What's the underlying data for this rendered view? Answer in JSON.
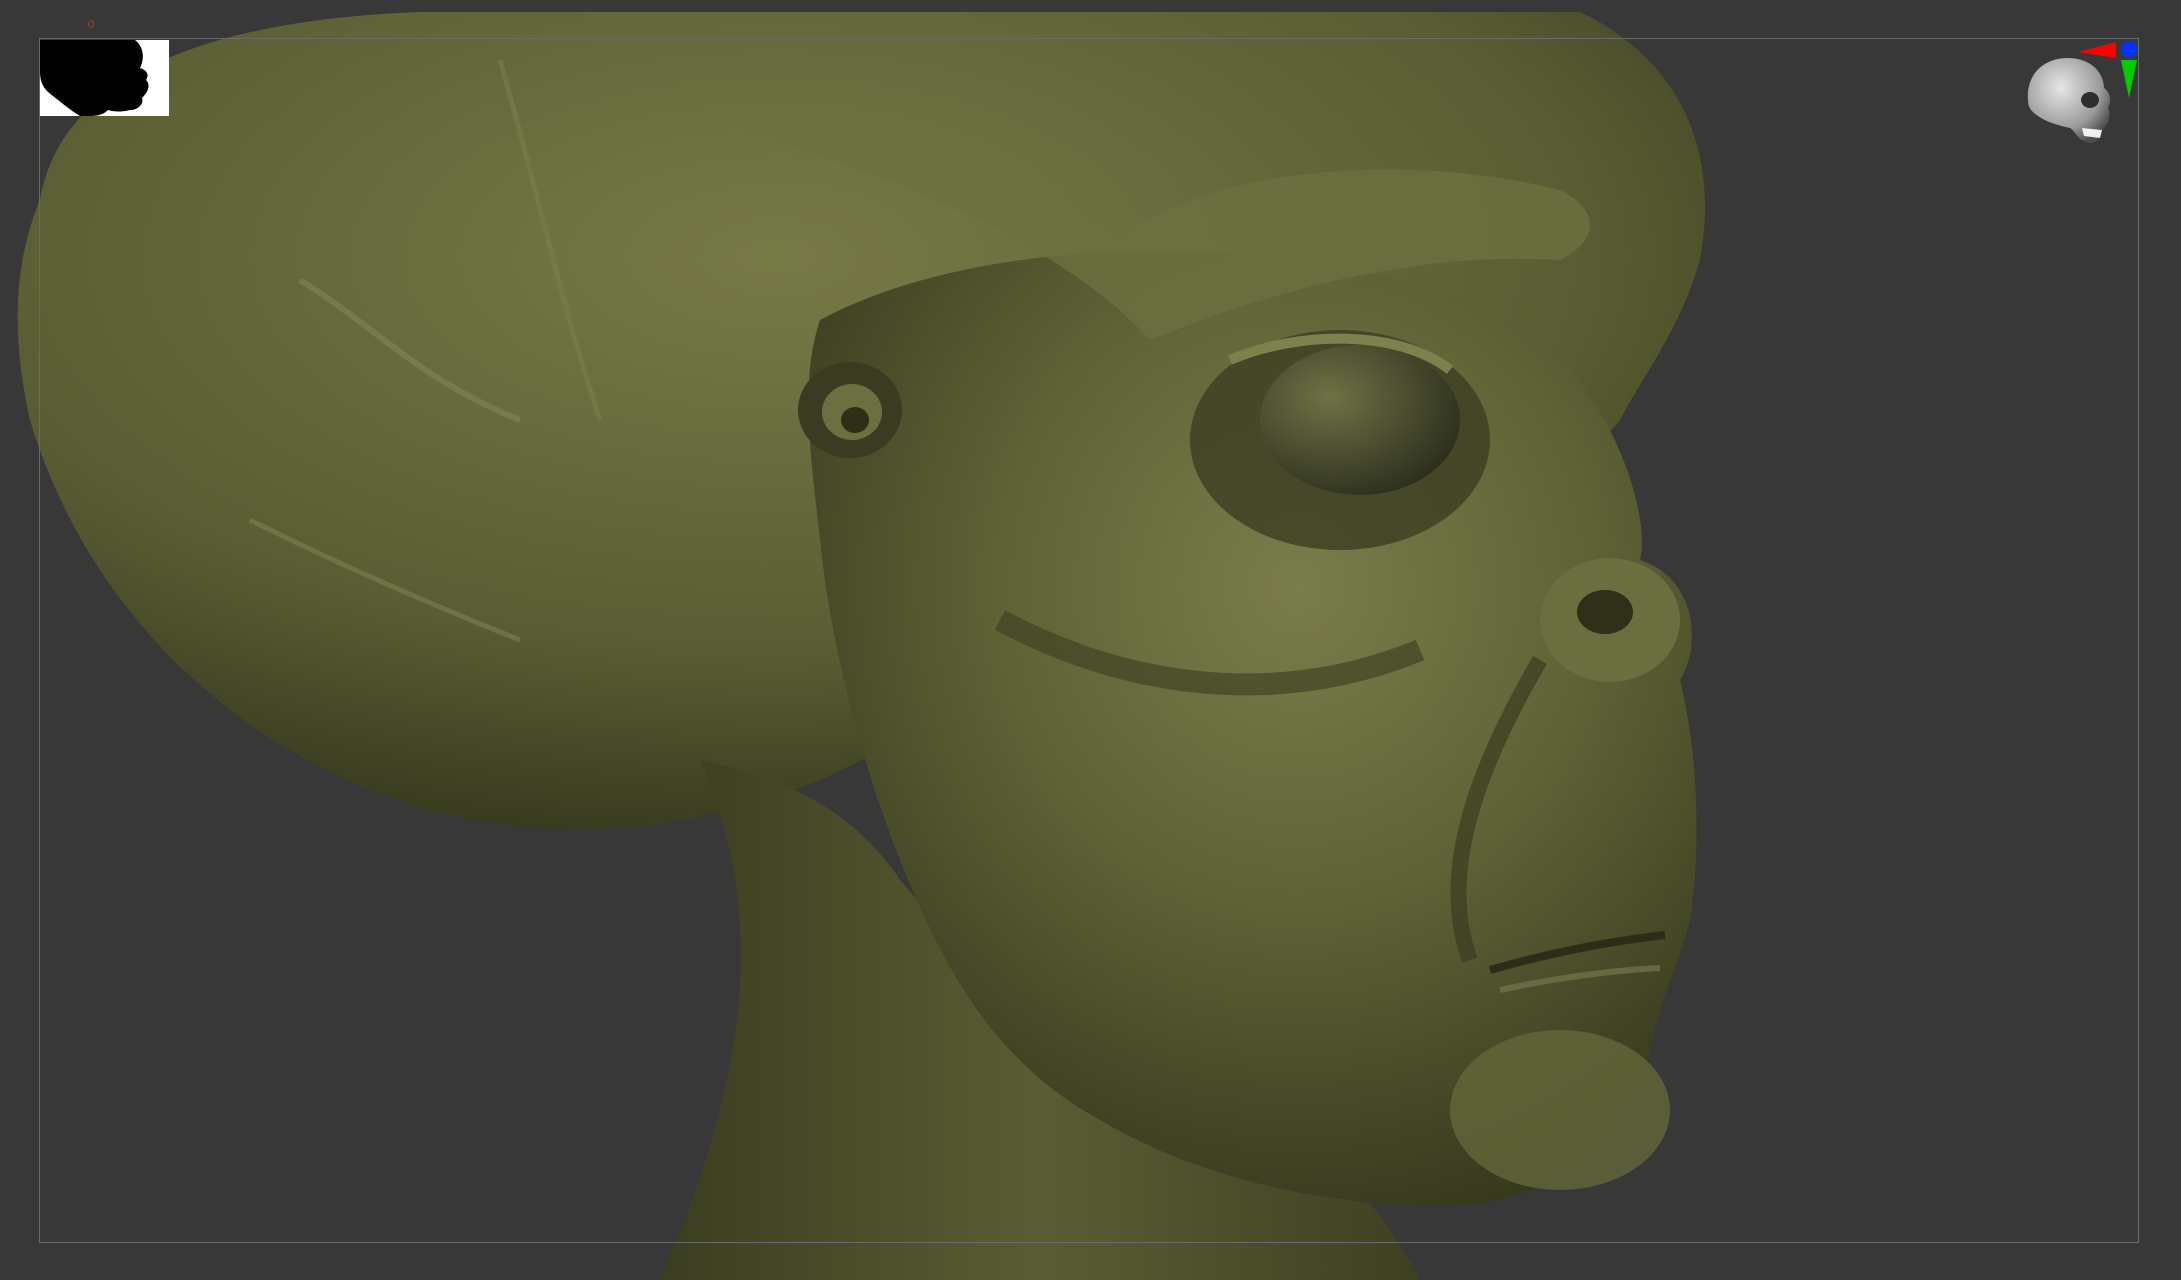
{
  "app": "ZBrush viewport",
  "viewport": {
    "background_color": "#383838",
    "frame_color": "#6a6a6a",
    "model": {
      "subject": "alien-head-sculpt",
      "material_color": "#5b5e34"
    },
    "frame_marker": {
      "label": "0",
      "color": "#c0392b"
    },
    "silhouette_thumbnail": {
      "icon": "head-silhouette-icon",
      "background": "#ffffff",
      "foreground": "#000000"
    },
    "navigation_gizmo": {
      "icon": "skull-orientation-icon",
      "axis_colors": {
        "x": "#ff0000",
        "y": "#00cc00",
        "z": "#0033ff"
      }
    }
  }
}
